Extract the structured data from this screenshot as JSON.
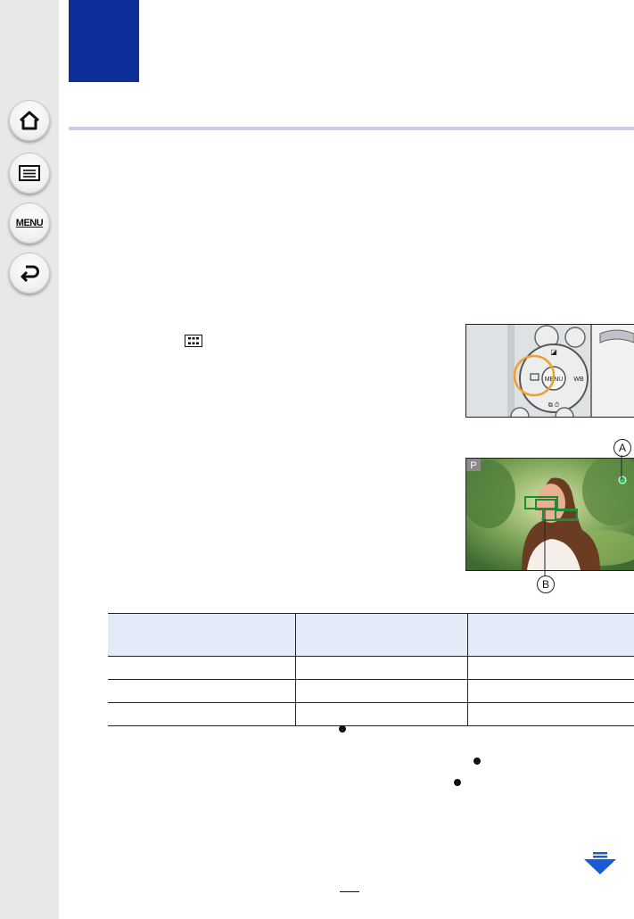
{
  "sidebar": {
    "buttons": [
      {
        "id": "home",
        "icon": "home-icon",
        "label": ""
      },
      {
        "id": "contents",
        "icon": "list-icon",
        "label": ""
      },
      {
        "id": "menu",
        "icon": "menu-text-icon",
        "label": "MENU"
      },
      {
        "id": "back",
        "icon": "return-arrow-icon",
        "label": ""
      }
    ]
  },
  "figures": {
    "dial_photo": {
      "description_icon": "af-area-button-icon"
    },
    "viewfinder_photo": {
      "mode_indicator": "P",
      "callout_a": "A",
      "callout_b": "B"
    }
  },
  "table": {
    "headers": [
      "",
      "",
      ""
    ],
    "rows": [
      [
        "",
        "",
        ""
      ],
      [
        "",
        "",
        ""
      ],
      [
        "",
        "",
        ""
      ]
    ]
  },
  "colors": {
    "chapter_tab": "#0e2f9a",
    "sidebar_bg": "#e7e8e8",
    "table_header": "#e3ebf8",
    "focus_ring": "#f0a030",
    "af_frame": "#1f8a3a",
    "next_arrow": "#1a5ad6"
  },
  "footer": {
    "page_number": ""
  }
}
